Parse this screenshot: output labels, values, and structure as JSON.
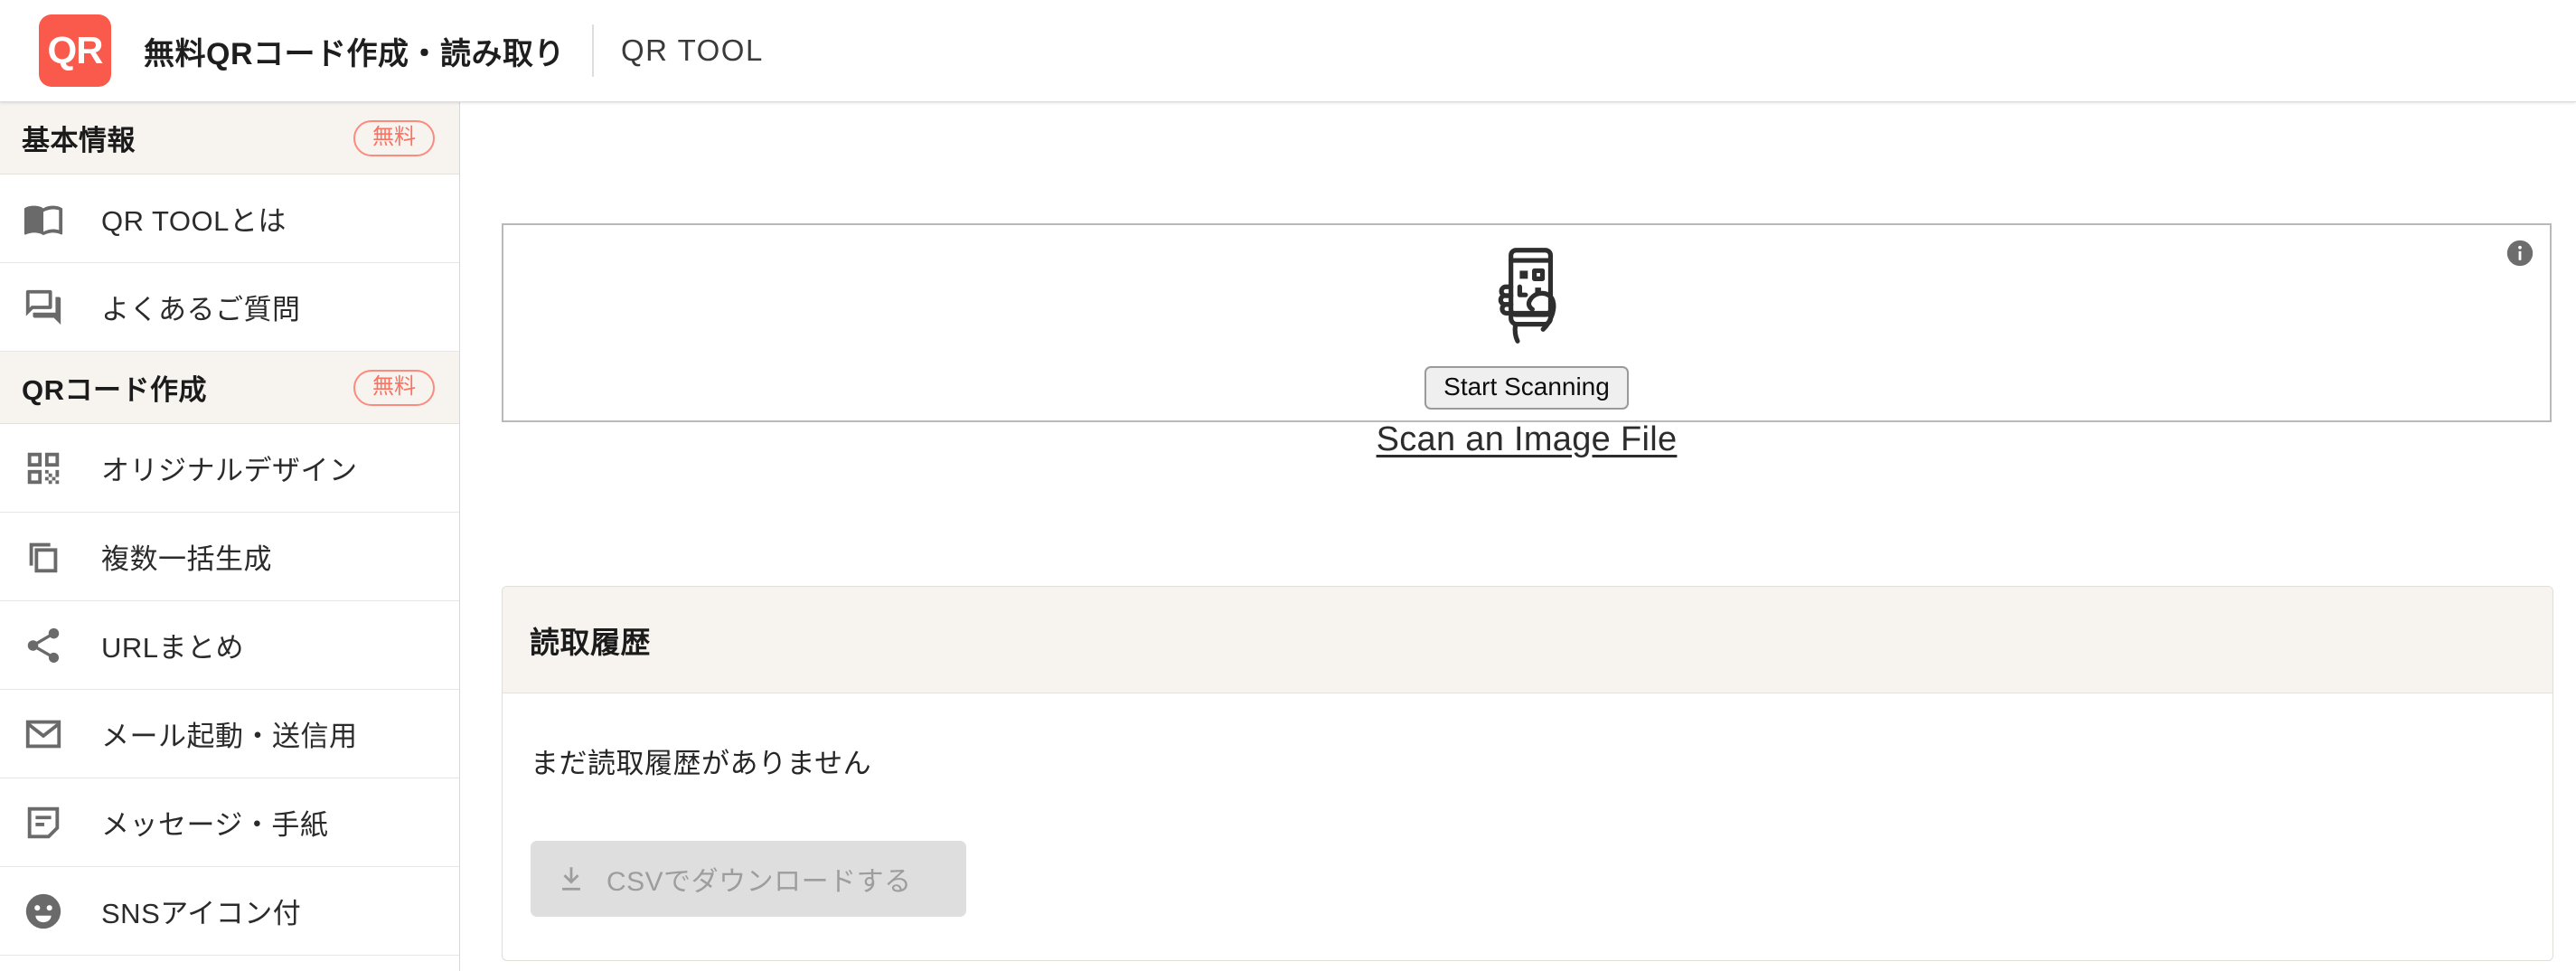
{
  "header": {
    "logo_text": "QR",
    "title": "無料QRコード作成・読み取り",
    "subtitle": "QR TOOL"
  },
  "sidebar": {
    "sections": [
      {
        "label": "基本情報",
        "badge": "無料",
        "items": [
          {
            "label": "QR TOOLとは",
            "icon": "book-icon"
          },
          {
            "label": "よくあるご質問",
            "icon": "chat-bubbles-icon"
          }
        ]
      },
      {
        "label": "QRコード作成",
        "badge": "無料",
        "items": [
          {
            "label": "オリジナルデザイン",
            "icon": "qr-code-icon"
          },
          {
            "label": "複数一括生成",
            "icon": "copy-icon"
          },
          {
            "label": "URLまとめ",
            "icon": "share-icon"
          },
          {
            "label": "メール起動・送信用",
            "icon": "mail-icon"
          },
          {
            "label": "メッセージ・手紙",
            "icon": "note-icon"
          },
          {
            "label": "SNSアイコン付",
            "icon": "smiley-face-icon"
          }
        ]
      }
    ]
  },
  "main": {
    "scanner": {
      "illustration_icon": "hand-holding-phone-qr-icon",
      "info_icon": "info-icon",
      "start_button": "Start Scanning",
      "image_file_link": "Scan an Image File"
    },
    "history": {
      "title": "読取履歴",
      "empty_message": "まだ読取履歴がありません",
      "download_button": "CSVでダウンロードする",
      "download_icon": "download-icon"
    }
  },
  "colors": {
    "brand": "#fa5a4b",
    "badge_border": "#fa8b7e",
    "badge_text": "#fa7262",
    "section_bg": "#f7f4f0",
    "panel_border": "#b9b9b9",
    "disabled_button_bg": "#dedede"
  }
}
